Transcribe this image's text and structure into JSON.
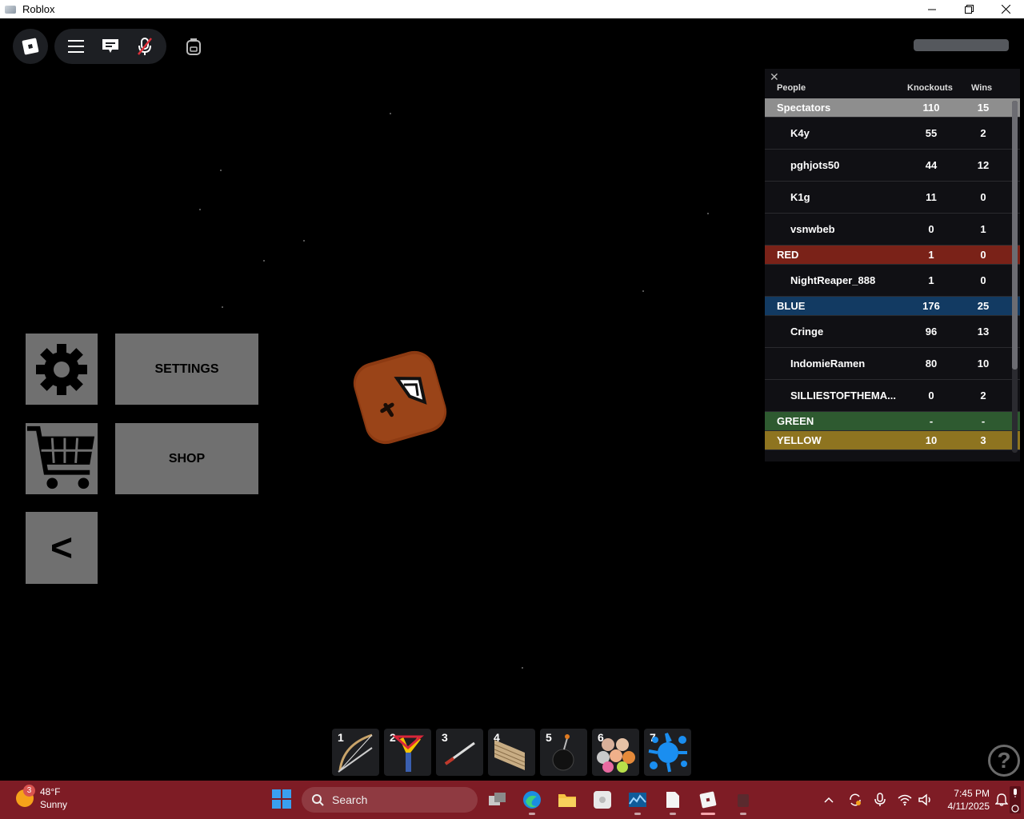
{
  "window": {
    "title": "Roblox"
  },
  "leaderboard": {
    "headers": {
      "people": "People",
      "knockouts": "Knockouts",
      "wins": "Wins"
    },
    "rows": [
      {
        "kind": "team",
        "name": "Spectators",
        "k": "110",
        "w": "15",
        "color": "#8e8e8e"
      },
      {
        "kind": "player",
        "name": "K4y",
        "k": "55",
        "w": "2"
      },
      {
        "kind": "player",
        "name": "pghjots50",
        "k": "44",
        "w": "12"
      },
      {
        "kind": "player",
        "name": "K1g",
        "k": "11",
        "w": "0"
      },
      {
        "kind": "player",
        "name": "vsnwbeb",
        "k": "0",
        "w": "1"
      },
      {
        "kind": "team",
        "name": "RED",
        "k": "1",
        "w": "0",
        "color": "#7a2218"
      },
      {
        "kind": "player",
        "name": "NightReaper_888",
        "k": "1",
        "w": "0"
      },
      {
        "kind": "team",
        "name": "BLUE",
        "k": "176",
        "w": "25",
        "color": "#123a62"
      },
      {
        "kind": "player",
        "name": "Cringe",
        "k": "96",
        "w": "13"
      },
      {
        "kind": "player",
        "name": "IndomieRamen",
        "k": "80",
        "w": "10"
      },
      {
        "kind": "player",
        "name": "SILLIESTOFTHEMA...",
        "k": "0",
        "w": "2"
      },
      {
        "kind": "team",
        "name": "GREEN",
        "k": "-",
        "w": "-",
        "color": "#2e5a30"
      },
      {
        "kind": "team",
        "name": "YELLOW",
        "k": "10",
        "w": "3",
        "color": "#8e7420"
      }
    ]
  },
  "side_menu": {
    "settings_label": "SETTINGS",
    "shop_label": "SHOP",
    "collapse_label": "<"
  },
  "hotbar": [
    {
      "num": "1",
      "tool": "bow"
    },
    {
      "num": "2",
      "tool": "slingshot"
    },
    {
      "num": "3",
      "tool": "sword"
    },
    {
      "num": "4",
      "tool": "wall"
    },
    {
      "num": "5",
      "tool": "bomb"
    },
    {
      "num": "6",
      "tool": "balls"
    },
    {
      "num": "7",
      "tool": "paint-splat"
    }
  ],
  "help": {
    "label": "?"
  },
  "taskbar": {
    "weather_temp": "48°F",
    "weather_desc": "Sunny",
    "weather_badge": "3",
    "search_placeholder": "Search",
    "time": "7:45 PM",
    "date": "4/11/2025"
  }
}
